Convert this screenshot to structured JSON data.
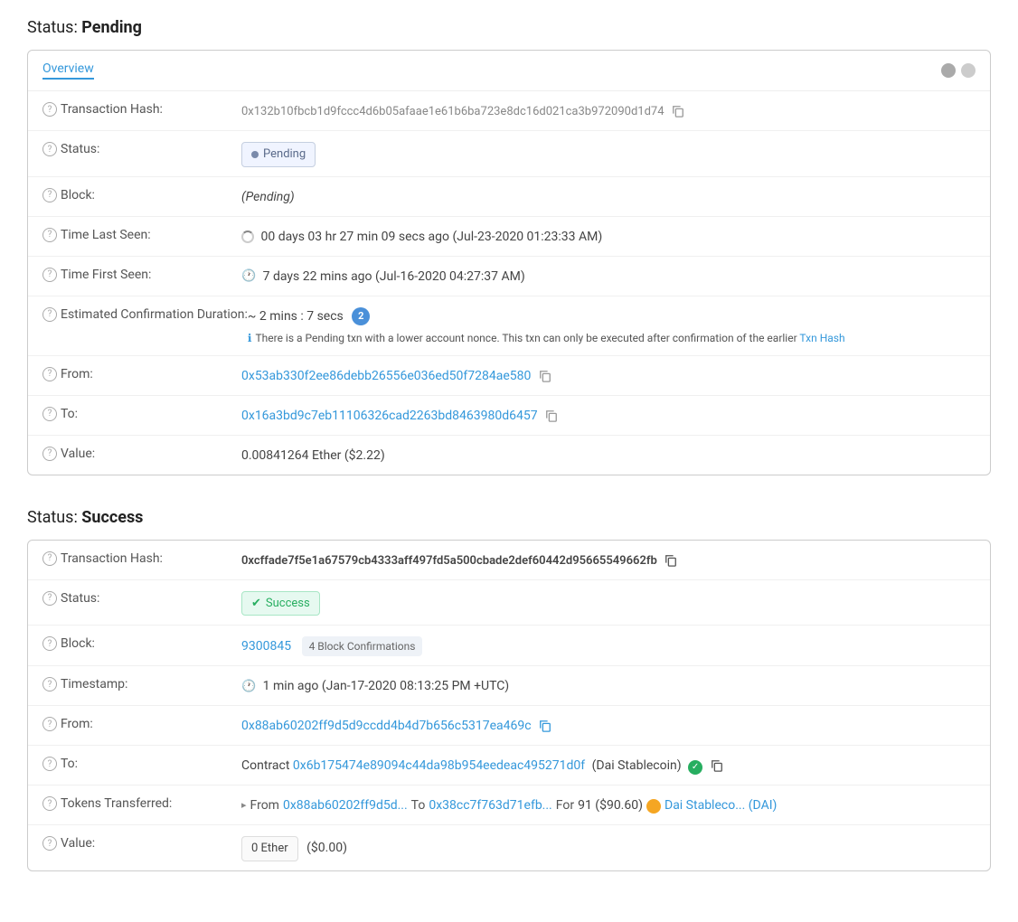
{
  "pending": {
    "sectionTitle": "Status:",
    "sectionStatus": "Pending",
    "tab": "Overview",
    "circleIcon1": "circle-gray",
    "circleIcon2": "circle-light",
    "rows": {
      "txHash": {
        "label": "Transaction Hash:",
        "value": "0x132b10fbcb1d9fccc4d6b05afaae1e61b6ba723e8dc16d021ca3b972090d1d74"
      },
      "status": {
        "label": "Status:",
        "badge": "Pending"
      },
      "block": {
        "label": "Block:",
        "value": "(Pending)"
      },
      "timeLastSeen": {
        "label": "Time Last Seen:",
        "value": "00 days 03 hr 27 min 09 secs ago (Jul-23-2020 01:23:33 AM)"
      },
      "timeFirstSeen": {
        "label": "Time First Seen:",
        "value": "7 days 22 mins ago (Jul-16-2020 04:27:37 AM)"
      },
      "estConfirmation": {
        "label": "Estimated Confirmation Duration:",
        "value": "~ 2 mins : 7 secs",
        "note": "There is a Pending txn with a lower account nonce. This txn can only be executed after confirmation of the earlier",
        "noteLinkText": "Txn Hash"
      },
      "from": {
        "label": "From:",
        "value": "0x53ab330f2ee86debb26556e036ed50f7284ae580"
      },
      "to": {
        "label": "To:",
        "value": "0x16a3bd9c7eb11106326cad2263bd8463980d6457"
      },
      "value": {
        "label": "Value:",
        "value": "0.00841264 Ether ($2.22)"
      }
    }
  },
  "success": {
    "sectionTitle": "Status:",
    "sectionStatus": "Success",
    "rows": {
      "txHash": {
        "label": "Transaction Hash:",
        "value": "0xcffade7f5e1a67579cb4333aff497fd5a500cbade2def60442d95665549662fb"
      },
      "status": {
        "label": "Status:",
        "badge": "Success"
      },
      "block": {
        "label": "Block:",
        "blockNumber": "9300845",
        "confirmations": "4 Block Confirmations"
      },
      "timestamp": {
        "label": "Timestamp:",
        "value": "1 min ago (Jan-17-2020 08:13:25 PM +UTC)"
      },
      "from": {
        "label": "From:",
        "value": "0x88ab60202ff9d5d9ccdd4b4d7b656c5317ea469c"
      },
      "to": {
        "label": "To:",
        "contractPrefix": "Contract",
        "contractAddress": "0x6b175474e89094c44da98b954eedeac495271d0f",
        "contractName": "(Dai Stablecoin)"
      },
      "tokensTransferred": {
        "label": "Tokens Transferred:",
        "from": "0x88ab60202ff9d5d...",
        "to": "0x38cc7f763d71efb...",
        "amount": "91 ($90.60)",
        "tokenName": "Dai Stableco... (DAI)"
      },
      "value": {
        "label": "Value:",
        "ethValue": "0 Ether",
        "usdValue": "($0.00)"
      }
    }
  },
  "icons": {
    "help": "?",
    "copy": "copy",
    "check": "✓",
    "info": "ℹ",
    "spinner": "⟳",
    "clock": "🕐",
    "arrow": "▸"
  }
}
